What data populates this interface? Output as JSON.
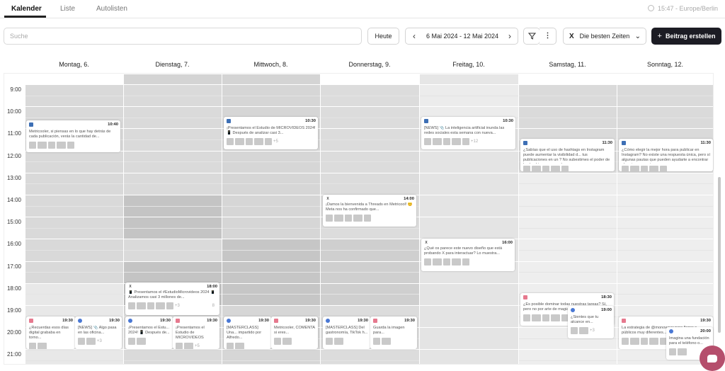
{
  "tabs": [
    {
      "label": "Kalender",
      "active": true
    },
    {
      "label": "Liste",
      "active": false
    },
    {
      "label": "Autolisten",
      "active": false
    }
  ],
  "timezone": "15:47 - Europe/Berlin",
  "search": {
    "placeholder": "Suche"
  },
  "toolbar": {
    "today_label": "Heute",
    "date_range": "6 Mai 2024 - 12 Mai 2024",
    "best_times_label": "Die besten Zeiten",
    "create_label": "Beitrag erstellen"
  },
  "days": [
    "Montag, 6.",
    "Dienstag, 7.",
    "Mittwoch, 8.",
    "Donnerstag, 9.",
    "Freitag, 10.",
    "Samstag, 11.",
    "Sonntag, 12."
  ],
  "hours": [
    "9:00",
    "10:00",
    "11:00",
    "12:00",
    "13:00",
    "14:00",
    "15:00",
    "16:00",
    "17:00",
    "18:00",
    "19:00",
    "20:00",
    "21:00"
  ],
  "posts": [
    {
      "time": "10:40",
      "net": "li",
      "text": "Metricooler, si piensas en lo que hay detrás de cada publicación, verás la cantidad de..."
    },
    {
      "time": "10:30",
      "net": "li",
      "text": "¡Presentamos el Estudio de MICROVIDEOS 2024! 📱 Después de analizar casi 3...",
      "more": "+5"
    },
    {
      "time": "10:30",
      "net": "li",
      "text": "[NEWS] 📎 La inteligencia artificial inunda las redes sociales esta semana con nueva...",
      "more": "+12"
    },
    {
      "time": "11:30",
      "net": "li",
      "text": "¿Sabías que el uso de hashtags en Instagram puede aumentar la visibilidad d... tus publicaciones en un ? No subestimes el poder de los hashtags y aprende a..."
    },
    {
      "time": "11:30",
      "net": "li",
      "text": "¿Cómo elegir la mejor hora para publicar en Instagram? No existe una respuesta única, pero sí algunas pautas que pueden ayudarte a encontrar el mejor momento"
    },
    {
      "time": "14:00",
      "net": "x",
      "text": "¡Damos la bienvenida a Threads en Metricool! 😊 Meta nos ha confirmado que..."
    },
    {
      "time": "16:00",
      "net": "x",
      "text": "¿Qué os parece este nuevo diseño que está probando X para interactuar? Lo muestra..."
    },
    {
      "time": "18:00",
      "net": "x",
      "text": "📱 Presentamos el #EstudioMicrovideos 2024 📱 Analizamos casi 3 millones de...",
      "more": "+3",
      "count": "8"
    },
    {
      "time": "18:30",
      "net": "ig",
      "text": "¿Es posible dominar todas nuestras tareas? Sí, pero no por arte de magia..."
    },
    {
      "time": "19:00",
      "net": "fb",
      "text": "¿Sientes que tu alcance en...",
      "more": "+3"
    },
    {
      "time": "19:30",
      "net": "ig",
      "text": "¿Recuerdas esos días digital grababa en torno..."
    },
    {
      "time": "19:30",
      "net": "fb",
      "text": "[NEWS] 📎 Algo pasa en las oficina...",
      "more": "+3"
    },
    {
      "time": "19:30",
      "net": "fb",
      "text": "¡Presentamos el Estu... 2024! 📱 Después de..."
    },
    {
      "time": "19:30",
      "net": "ig",
      "text": "¡Presentamos el Estudio de MICROVIDEOS",
      "more": "+5"
    },
    {
      "time": "19:30",
      "net": "fb",
      "text": "[MASTERCLASS] Una... impartido por Alfredo..."
    },
    {
      "time": "19:30",
      "net": "ig",
      "text": "Metricooler, COMENTA si eres..."
    },
    {
      "time": "19:30",
      "net": "fb",
      "text": "[MASTERCLASS] Del gastronomía, TikTok h..."
    },
    {
      "time": "19:30",
      "net": "ig",
      "text": "Guarda la imagen para..."
    },
    {
      "time": "19:30",
      "net": "ig",
      "text": "La estrategia de @monowear para llegar a públicos muy diferentes..."
    },
    {
      "time": "20:00",
      "net": "fb",
      "text": "Imagina una fundación para el teléfono o..."
    }
  ]
}
